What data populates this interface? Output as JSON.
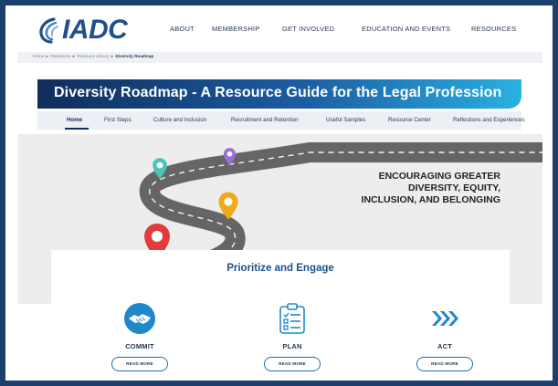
{
  "brand": {
    "logo_text": "IADC",
    "accent": "#1f4f8c",
    "border": "#1d3f6e"
  },
  "topnav": [
    {
      "label": "ABOUT"
    },
    {
      "label": "MEMBERSHIP"
    },
    {
      "label": "GET INVOLVED"
    },
    {
      "label": "EDUCATION AND EVENTS"
    },
    {
      "label": "RESOURCES"
    }
  ],
  "breadcrumb": {
    "items": [
      "Home",
      "Resources",
      "Resource Library"
    ],
    "separator": "►",
    "current": "Diversity Roadmap"
  },
  "banner": {
    "title": "Diversity Roadmap - A Resource Guide for the Legal Profession"
  },
  "subnav": [
    {
      "label": "Home",
      "active": true
    },
    {
      "label": "First Steps"
    },
    {
      "label": "Culture and Inclusion"
    },
    {
      "label": "Recruitment and Retention"
    },
    {
      "label": "Useful Samples"
    },
    {
      "label": "Resource Center"
    },
    {
      "label": "Reflections and Experiences"
    }
  ],
  "hero": {
    "lines": [
      "ENCOURAGING GREATER",
      "DIVERSITY, EQUITY,",
      "INCLUSION, AND BELONGING"
    ],
    "pin_colors": [
      "#e23b3b",
      "#f2a81d",
      "#4ec3b6",
      "#9b6fd6"
    ]
  },
  "section": {
    "title": "Prioritize and Engage",
    "items": [
      {
        "label": "COMMIT",
        "button": "READ MORE",
        "icon": "handshake-icon"
      },
      {
        "label": "PLAN",
        "button": "READ MORE",
        "icon": "checklist-icon"
      },
      {
        "label": "ACT",
        "button": "READ MORE",
        "icon": "chevrons-right-icon"
      }
    ]
  }
}
